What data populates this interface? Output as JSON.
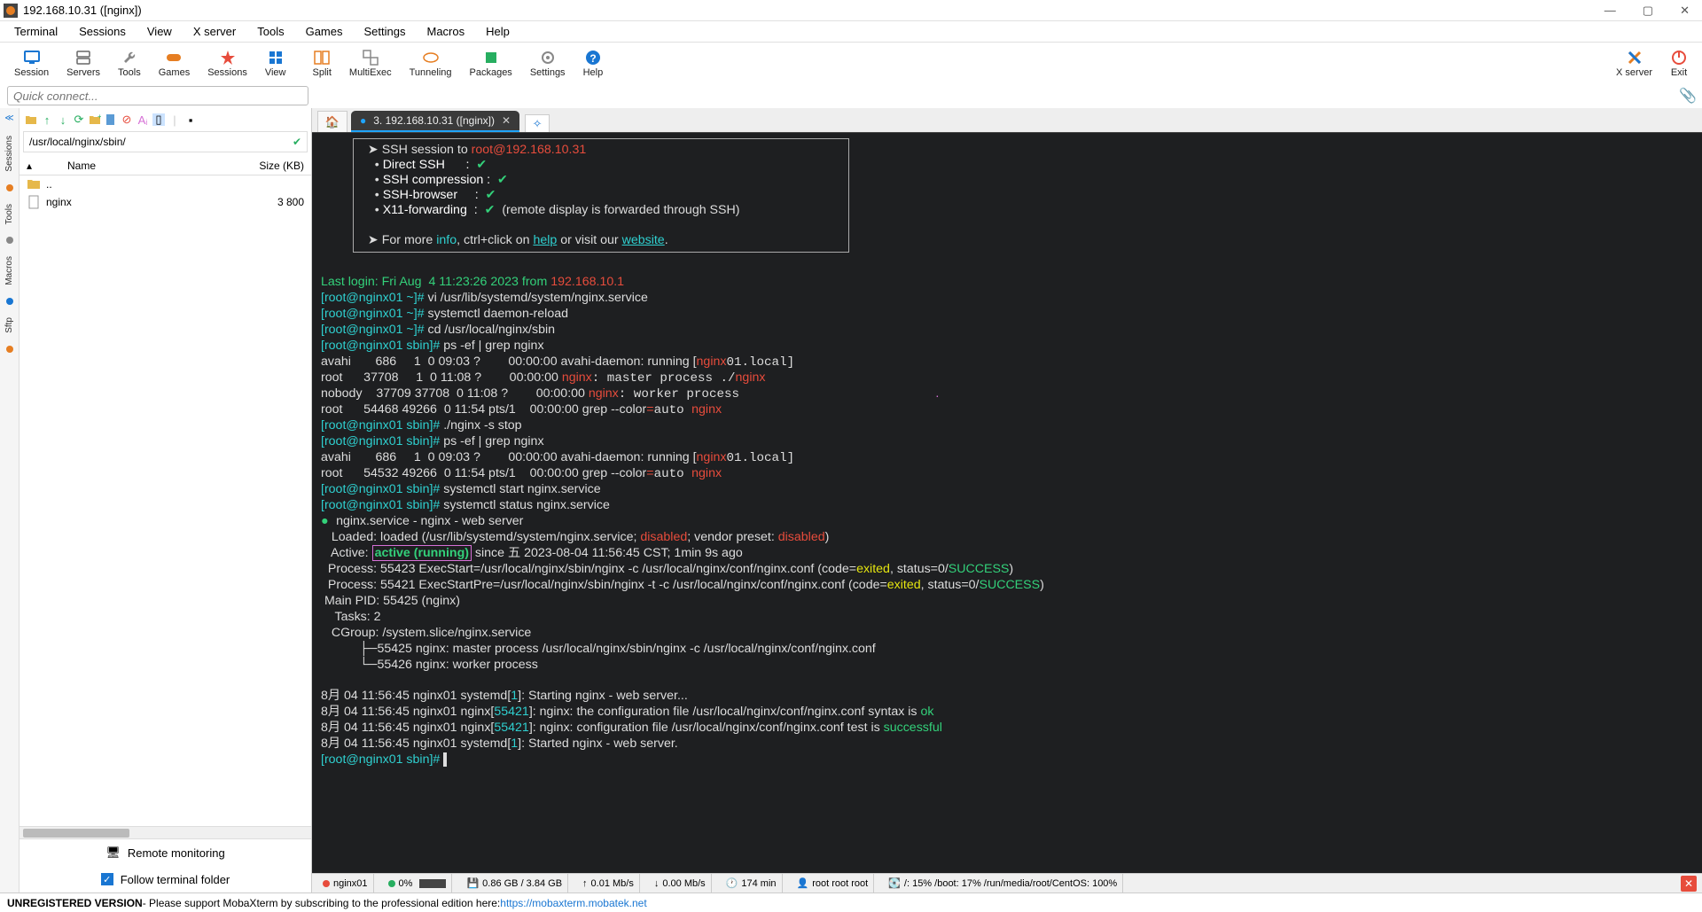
{
  "window_title": "192.168.10.31 ([nginx])",
  "menu": [
    "Terminal",
    "Sessions",
    "View",
    "X server",
    "Tools",
    "Games",
    "Settings",
    "Macros",
    "Help"
  ],
  "tools": [
    {
      "label": "Session",
      "icon": "monitor",
      "color": "#1976d2"
    },
    {
      "label": "Servers",
      "icon": "server",
      "color": "#444"
    },
    {
      "label": "Tools",
      "icon": "wrench",
      "color": "#888"
    },
    {
      "label": "Games",
      "icon": "gamepad",
      "color": "#e67e22"
    },
    {
      "label": "Sessions",
      "icon": "list",
      "color": "#e74c3c"
    },
    {
      "label": "View",
      "icon": "grid",
      "color": "#1976d2"
    },
    {
      "label": "Split",
      "icon": "split",
      "color": "#e67e22"
    },
    {
      "label": "MultiExec",
      "icon": "multi",
      "color": "#888"
    },
    {
      "label": "Tunneling",
      "icon": "tunnel",
      "color": "#e67e22"
    },
    {
      "label": "Packages",
      "icon": "package",
      "color": "#27ae60"
    },
    {
      "label": "Settings",
      "icon": "gear",
      "color": "#888"
    },
    {
      "label": "Help",
      "icon": "help",
      "color": "#1976d2"
    }
  ],
  "tools_right": [
    {
      "label": "X server",
      "icon": "x",
      "color": "#e67e22"
    },
    {
      "label": "Exit",
      "icon": "power",
      "color": "#e74c3c"
    }
  ],
  "quick_placeholder": "Quick connect...",
  "side_tabs": [
    "Sessions",
    "Tools",
    "Macros",
    "Sftp"
  ],
  "side_path": "/usr/local/nginx/sbin/",
  "file_cols": {
    "name": "Name",
    "size": "Size (KB)"
  },
  "files": [
    {
      "name": "..",
      "size": "",
      "icon": "folder"
    },
    {
      "name": "nginx",
      "size": "3 800",
      "icon": "file"
    }
  ],
  "side_opts": [
    {
      "label": "Remote monitoring",
      "icon": "monitor-remote"
    },
    {
      "label": "Follow terminal folder",
      "icon": "checkbox"
    }
  ],
  "tab_label": "3. 192.168.10.31 ([nginx])",
  "terminal": {
    "banner": {
      "l1_a": "SSH session to ",
      "l1_b": "root@192.168.10.31",
      "l2": "Direct SSH      :  ",
      "l2c": "✔",
      "l3": "SSH compression :  ",
      "l3c": "✔",
      "l4": "SSH-browser     :  ",
      "l4c": "✔",
      "l5": "X11-forwarding  :  ",
      "l5c": "✔",
      "l5t": "  (remote display is forwarded through SSH)",
      "l6a": "For more ",
      "l6b": "info",
      "l6c": ", ctrl+click on ",
      "l6d": "help",
      "l6e": " or visit our ",
      "l6f": "website",
      "l6g": "."
    },
    "last_login": "Last login: Fri Aug  4 11:23:26 2023 from ",
    "last_login_ip": "192.168.10.1",
    "lines": [
      {
        "p": "[root@nginx01 ~]# ",
        "c": "vi /usr/lib/systemd/system/nginx.service"
      },
      {
        "p": "[root@nginx01 ~]# ",
        "c": "systemctl daemon-reload"
      },
      {
        "p": "[root@nginx01 ~]# ",
        "c": "cd /usr/local/nginx/sbin"
      },
      {
        "p": "[root@nginx01 sbin]# ",
        "c": "ps -ef | grep nginx"
      }
    ],
    "ps1": [
      "avahi       686     1  0 09:03 ?        00:00:00 avahi-daemon: running [",
      "root      37708     1  0 11:08 ?        00:00:00 ",
      "nobody    37709 37708  0 11:08 ?        00:00:00 ",
      "root      54468 49266  0 11:54 pts/1    00:00:00 grep --color"
    ],
    "stop_line": {
      "p": "[root@nginx01 sbin]# ",
      "c": "./nginx -s stop"
    },
    "ps2_cmd": {
      "p": "[root@nginx01 sbin]# ",
      "c": "ps -ef | grep nginx"
    },
    "ps2": [
      "avahi       686     1  0 09:03 ?        00:00:00 avahi-daemon: running [",
      "root      54532 49266  0 11:54 pts/1    00:00:00 grep --color"
    ],
    "start_cmd": {
      "p": "[root@nginx01 sbin]# ",
      "c": "systemctl start nginx.service"
    },
    "status_cmd": {
      "p": "[root@nginx01 sbin]# ",
      "c": "systemctl status nginx.service"
    },
    "status": {
      "l1": "nginx.service - nginx - web server",
      "l2a": "   Loaded: loaded (/usr/lib/systemd/system/nginx.service; ",
      "l2b": "disabled",
      "l2c": "; vendor preset: ",
      "l2d": "disabled",
      "l2e": ")",
      "l3a": "   Active: ",
      "l3b": "active (running)",
      "l3c": " since 五 2023-08-04 11:56:45 CST; 1min 9s ago",
      "l4a": "  Process: 55423 ExecStart=/usr/local/nginx/sbin/nginx -c /usr/local/nginx/conf/nginx.conf (code=",
      "l4b": "exited",
      "l4c": ", status=0/",
      "l4d": "SUCCESS",
      "l4e": ")",
      "l5a": "  Process: 55421 ExecStartPre=/usr/local/nginx/sbin/nginx -t -c /usr/local/nginx/conf/nginx.conf (code=",
      "l5b": "exited",
      "l5c": ", status=0/",
      "l5d": "SUCCESS",
      "l5e": ")",
      "l6": " Main PID: 55425 (nginx)",
      "l7": "    Tasks: 2",
      "l8": "   CGroup: /system.slice/nginx.service",
      "l9": "           ├─55425 nginx: master process /usr/local/nginx/sbin/nginx -c /usr/local/nginx/conf/nginx.conf",
      "l10": "           └─55426 nginx: worker process"
    },
    "log": [
      {
        "a": "8月 04 11:56:45 nginx01 systemd[",
        "n": "1",
        "b": "]: Starting nginx - web server..."
      },
      {
        "a": "8月 04 11:56:45 nginx01 nginx[",
        "n": "55421",
        "b": "]: nginx: the configuration file /usr/local/nginx/conf/nginx.conf syntax is ",
        "ok": "ok"
      },
      {
        "a": "8月 04 11:56:45 nginx01 nginx[",
        "n": "55421",
        "b": "]: nginx: configuration file /usr/local/nginx/conf/nginx.conf test is ",
        "ok": "successful"
      },
      {
        "a": "8月 04 11:56:45 nginx01 systemd[",
        "n": "1",
        "b": "]: Started nginx - web server."
      }
    ],
    "final_prompt": "[root@nginx01 sbin]# "
  },
  "status_bar": {
    "host": "nginx01",
    "cpu": "0%",
    "mem": "0.86 GB / 3.84 GB",
    "up": "0.01 Mb/s",
    "down": "0.00 Mb/s",
    "uptime": "174 min",
    "user": "root  root  root",
    "disks": "/: 15%    /boot: 17%    /run/media/root/CentOS: 100%"
  },
  "footer": {
    "a": "UNREGISTERED VERSION",
    "b": "  -  Please support MobaXterm by subscribing to the professional edition here:  ",
    "link": "https://mobaxterm.mobatek.net"
  }
}
